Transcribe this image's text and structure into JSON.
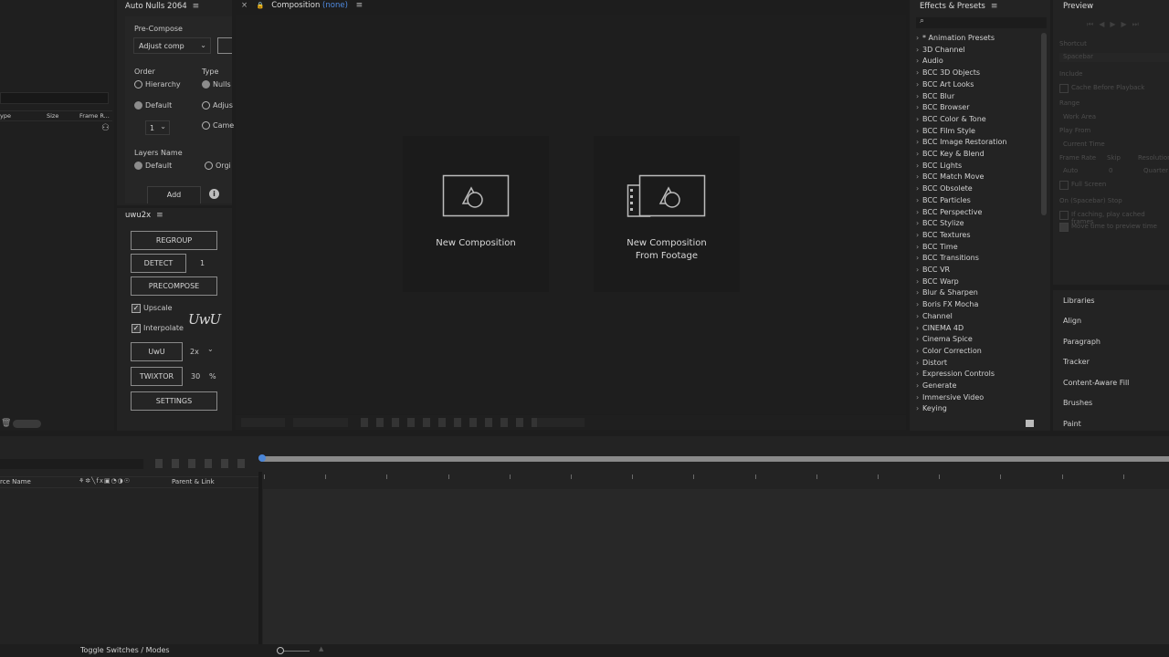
{
  "left_panel": {
    "columns": [
      "ype",
      "Size",
      "Frame R..."
    ]
  },
  "autonulls": {
    "title": "Auto Nulls 2064",
    "precompose_label": "Pre-Compose",
    "precompose_value": "Adjust comp",
    "order_label": "Order",
    "type_label": "Type",
    "order_options": [
      "Hierarchy",
      "Default"
    ],
    "type_options": [
      "Nulls",
      "Adjus",
      "Came"
    ],
    "order_number": "1",
    "layers_name_label": "Layers Name",
    "layers_name_options": [
      "Default",
      "Orgi"
    ],
    "add_label": "Add"
  },
  "uwu": {
    "title": "uwu2x",
    "regroup": "REGROUP",
    "detect": "DETECT",
    "detect_value": "1",
    "precompose": "PRECOMPOSE",
    "upscale": "Upscale",
    "interpolate": "Interpolate",
    "logo": "UwU",
    "uwu_button": "UwU",
    "scale_value": "2x",
    "twixtor": "TWIXTOR",
    "twixtor_value": "30",
    "percent": "%",
    "settings": "SETTINGS"
  },
  "composition": {
    "tab_label": "Composition",
    "tab_value": "(none)",
    "new_comp": "New Composition",
    "new_comp_footage_line1": "New Composition",
    "new_comp_footage_line2": "From Footage"
  },
  "effects": {
    "title": "Effects & Presets",
    "items": [
      "* Animation Presets",
      "3D Channel",
      "Audio",
      "BCC 3D Objects",
      "BCC Art Looks",
      "BCC Blur",
      "BCC Browser",
      "BCC Color & Tone",
      "BCC Film Style",
      "BCC Image Restoration",
      "BCC Key & Blend",
      "BCC Lights",
      "BCC Match Move",
      "BCC Obsolete",
      "BCC Particles",
      "BCC Perspective",
      "BCC Stylize",
      "BCC Textures",
      "BCC Time",
      "BCC Transitions",
      "BCC VR",
      "BCC Warp",
      "Blur & Sharpen",
      "Boris FX Mocha",
      "Channel",
      "CINEMA 4D",
      "Cinema Spice",
      "Color Correction",
      "Distort",
      "Expression Controls",
      "Generate",
      "Immersive Video",
      "Keying"
    ]
  },
  "preview": {
    "title": "Preview",
    "dim_labels": [
      "Shortcut",
      "Spacebar",
      "Include",
      "Cache Before Playback",
      "Range",
      "Work Area",
      "Play From",
      "Current Time",
      "Frame Rate",
      "Skip",
      "Resolution",
      "Auto",
      "0",
      "Quarter",
      "Full Screen",
      "On (Spacebar) Stop",
      "If caching, play cached frames",
      "Move time to preview time"
    ]
  },
  "right_panels": [
    "Libraries",
    "Align",
    "Paragraph",
    "Tracker",
    "Content-Aware Fill",
    "Brushes",
    "Paint"
  ],
  "timeline": {
    "source_name": "rce Name",
    "parent_link": "Parent & Link",
    "toggle_label": "Toggle Switches / Modes"
  }
}
